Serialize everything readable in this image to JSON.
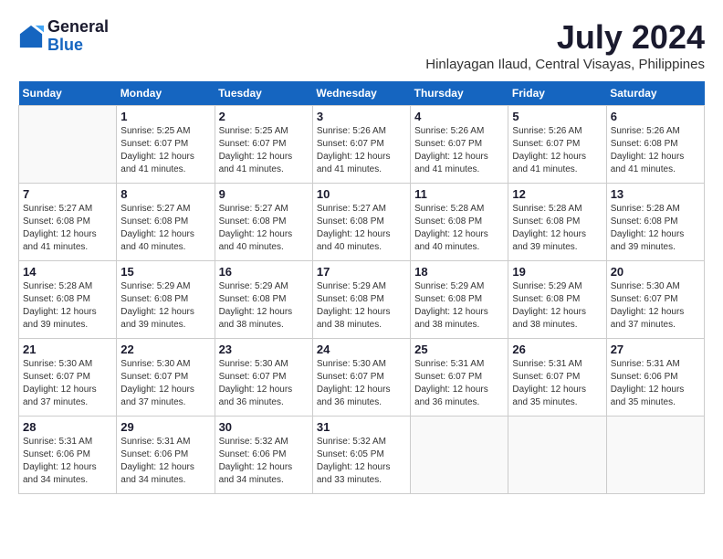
{
  "logo": {
    "general": "General",
    "blue": "Blue"
  },
  "title": "July 2024",
  "subtitle": "Hinlayagan Ilaud, Central Visayas, Philippines",
  "weekdays": [
    "Sunday",
    "Monday",
    "Tuesday",
    "Wednesday",
    "Thursday",
    "Friday",
    "Saturday"
  ],
  "weeks": [
    [
      {
        "day": "",
        "sunrise": "",
        "sunset": "",
        "daylight": ""
      },
      {
        "day": "1",
        "sunrise": "Sunrise: 5:25 AM",
        "sunset": "Sunset: 6:07 PM",
        "daylight": "Daylight: 12 hours and 41 minutes."
      },
      {
        "day": "2",
        "sunrise": "Sunrise: 5:25 AM",
        "sunset": "Sunset: 6:07 PM",
        "daylight": "Daylight: 12 hours and 41 minutes."
      },
      {
        "day": "3",
        "sunrise": "Sunrise: 5:26 AM",
        "sunset": "Sunset: 6:07 PM",
        "daylight": "Daylight: 12 hours and 41 minutes."
      },
      {
        "day": "4",
        "sunrise": "Sunrise: 5:26 AM",
        "sunset": "Sunset: 6:07 PM",
        "daylight": "Daylight: 12 hours and 41 minutes."
      },
      {
        "day": "5",
        "sunrise": "Sunrise: 5:26 AM",
        "sunset": "Sunset: 6:07 PM",
        "daylight": "Daylight: 12 hours and 41 minutes."
      },
      {
        "day": "6",
        "sunrise": "Sunrise: 5:26 AM",
        "sunset": "Sunset: 6:08 PM",
        "daylight": "Daylight: 12 hours and 41 minutes."
      }
    ],
    [
      {
        "day": "7",
        "sunrise": "Sunrise: 5:27 AM",
        "sunset": "Sunset: 6:08 PM",
        "daylight": "Daylight: 12 hours and 41 minutes."
      },
      {
        "day": "8",
        "sunrise": "Sunrise: 5:27 AM",
        "sunset": "Sunset: 6:08 PM",
        "daylight": "Daylight: 12 hours and 40 minutes."
      },
      {
        "day": "9",
        "sunrise": "Sunrise: 5:27 AM",
        "sunset": "Sunset: 6:08 PM",
        "daylight": "Daylight: 12 hours and 40 minutes."
      },
      {
        "day": "10",
        "sunrise": "Sunrise: 5:27 AM",
        "sunset": "Sunset: 6:08 PM",
        "daylight": "Daylight: 12 hours and 40 minutes."
      },
      {
        "day": "11",
        "sunrise": "Sunrise: 5:28 AM",
        "sunset": "Sunset: 6:08 PM",
        "daylight": "Daylight: 12 hours and 40 minutes."
      },
      {
        "day": "12",
        "sunrise": "Sunrise: 5:28 AM",
        "sunset": "Sunset: 6:08 PM",
        "daylight": "Daylight: 12 hours and 39 minutes."
      },
      {
        "day": "13",
        "sunrise": "Sunrise: 5:28 AM",
        "sunset": "Sunset: 6:08 PM",
        "daylight": "Daylight: 12 hours and 39 minutes."
      }
    ],
    [
      {
        "day": "14",
        "sunrise": "Sunrise: 5:28 AM",
        "sunset": "Sunset: 6:08 PM",
        "daylight": "Daylight: 12 hours and 39 minutes."
      },
      {
        "day": "15",
        "sunrise": "Sunrise: 5:29 AM",
        "sunset": "Sunset: 6:08 PM",
        "daylight": "Daylight: 12 hours and 39 minutes."
      },
      {
        "day": "16",
        "sunrise": "Sunrise: 5:29 AM",
        "sunset": "Sunset: 6:08 PM",
        "daylight": "Daylight: 12 hours and 38 minutes."
      },
      {
        "day": "17",
        "sunrise": "Sunrise: 5:29 AM",
        "sunset": "Sunset: 6:08 PM",
        "daylight": "Daylight: 12 hours and 38 minutes."
      },
      {
        "day": "18",
        "sunrise": "Sunrise: 5:29 AM",
        "sunset": "Sunset: 6:08 PM",
        "daylight": "Daylight: 12 hours and 38 minutes."
      },
      {
        "day": "19",
        "sunrise": "Sunrise: 5:29 AM",
        "sunset": "Sunset: 6:08 PM",
        "daylight": "Daylight: 12 hours and 38 minutes."
      },
      {
        "day": "20",
        "sunrise": "Sunrise: 5:30 AM",
        "sunset": "Sunset: 6:07 PM",
        "daylight": "Daylight: 12 hours and 37 minutes."
      }
    ],
    [
      {
        "day": "21",
        "sunrise": "Sunrise: 5:30 AM",
        "sunset": "Sunset: 6:07 PM",
        "daylight": "Daylight: 12 hours and 37 minutes."
      },
      {
        "day": "22",
        "sunrise": "Sunrise: 5:30 AM",
        "sunset": "Sunset: 6:07 PM",
        "daylight": "Daylight: 12 hours and 37 minutes."
      },
      {
        "day": "23",
        "sunrise": "Sunrise: 5:30 AM",
        "sunset": "Sunset: 6:07 PM",
        "daylight": "Daylight: 12 hours and 36 minutes."
      },
      {
        "day": "24",
        "sunrise": "Sunrise: 5:30 AM",
        "sunset": "Sunset: 6:07 PM",
        "daylight": "Daylight: 12 hours and 36 minutes."
      },
      {
        "day": "25",
        "sunrise": "Sunrise: 5:31 AM",
        "sunset": "Sunset: 6:07 PM",
        "daylight": "Daylight: 12 hours and 36 minutes."
      },
      {
        "day": "26",
        "sunrise": "Sunrise: 5:31 AM",
        "sunset": "Sunset: 6:07 PM",
        "daylight": "Daylight: 12 hours and 35 minutes."
      },
      {
        "day": "27",
        "sunrise": "Sunrise: 5:31 AM",
        "sunset": "Sunset: 6:06 PM",
        "daylight": "Daylight: 12 hours and 35 minutes."
      }
    ],
    [
      {
        "day": "28",
        "sunrise": "Sunrise: 5:31 AM",
        "sunset": "Sunset: 6:06 PM",
        "daylight": "Daylight: 12 hours and 34 minutes."
      },
      {
        "day": "29",
        "sunrise": "Sunrise: 5:31 AM",
        "sunset": "Sunset: 6:06 PM",
        "daylight": "Daylight: 12 hours and 34 minutes."
      },
      {
        "day": "30",
        "sunrise": "Sunrise: 5:32 AM",
        "sunset": "Sunset: 6:06 PM",
        "daylight": "Daylight: 12 hours and 34 minutes."
      },
      {
        "day": "31",
        "sunrise": "Sunrise: 5:32 AM",
        "sunset": "Sunset: 6:05 PM",
        "daylight": "Daylight: 12 hours and 33 minutes."
      },
      {
        "day": "",
        "sunrise": "",
        "sunset": "",
        "daylight": ""
      },
      {
        "day": "",
        "sunrise": "",
        "sunset": "",
        "daylight": ""
      },
      {
        "day": "",
        "sunrise": "",
        "sunset": "",
        "daylight": ""
      }
    ]
  ]
}
